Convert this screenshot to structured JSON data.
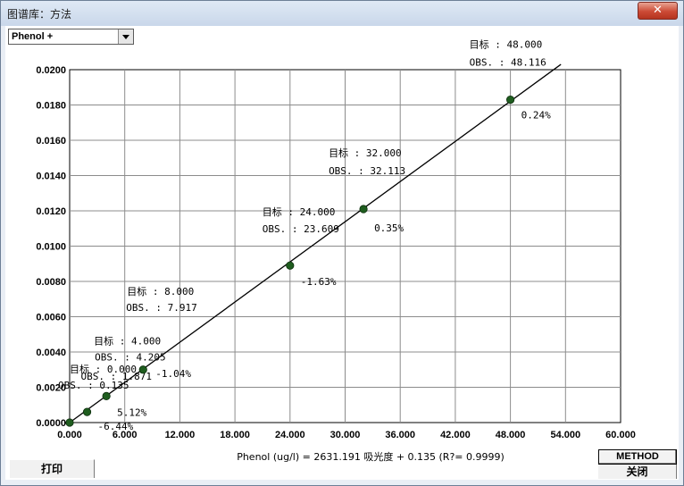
{
  "window": {
    "title": "图谱库：方法",
    "close_glyph": "✕"
  },
  "selector": {
    "value": "Phenol +"
  },
  "buttons": {
    "print_label": "打印",
    "method_label": "METHOD",
    "close_label": "关闭"
  },
  "colors": {
    "point_fill": "#1f5d1f",
    "line": "#000000",
    "grid": "#8c8c8c"
  },
  "chart_data": {
    "type": "scatter",
    "x_tick_labels": [
      "0.000",
      "6.000",
      "12.000",
      "18.000",
      "24.000",
      "30.000",
      "36.000",
      "42.000",
      "48.000",
      "54.000",
      "60.000"
    ],
    "y_tick_labels": [
      "0.0000",
      "0.0020",
      "0.0040",
      "0.0060",
      "0.0080",
      "0.0100",
      "0.0120",
      "0.0140",
      "0.0160",
      "0.0180",
      "0.0200"
    ],
    "xlim": [
      0,
      60
    ],
    "ylim": [
      0,
      0.02
    ],
    "grid": true,
    "equation": "Phenol  (ug/l) = 2631.191 吸光度 + 0.135  (R?= 0.9999)",
    "fit_line": {
      "x": [
        0,
        53.5
      ],
      "y": [
        0,
        0.0203
      ]
    },
    "points": [
      {
        "x": 0.0,
        "y": 0.0,
        "target": "目标 : 0.000",
        "obs": "OBS. : 0.135",
        "error": ""
      },
      {
        "x": 1.9,
        "y": 0.0006,
        "target": "",
        "obs": "OBS. : 1.871",
        "error": "-6.44%"
      },
      {
        "x": 4.0,
        "y": 0.0015,
        "target": "目标 : 4.000",
        "obs": "OBS. : 4.205",
        "error": "5.12%"
      },
      {
        "x": 8.0,
        "y": 0.003,
        "target": "目标 : 8.000",
        "obs": "OBS. : 7.917",
        "error": "-1.04%"
      },
      {
        "x": 24.0,
        "y": 0.0089,
        "target": "目标 : 24.000",
        "obs": "OBS. : 23.609",
        "error": "-1.63%"
      },
      {
        "x": 32.0,
        "y": 0.0121,
        "target": "目标 : 32.000",
        "obs": "OBS. : 32.113",
        "error": "0.35%"
      },
      {
        "x": 48.0,
        "y": 0.0183,
        "target": "目标 : 48.000",
        "obs": "OBS. : 48.116",
        "error": "0.24%"
      }
    ]
  }
}
